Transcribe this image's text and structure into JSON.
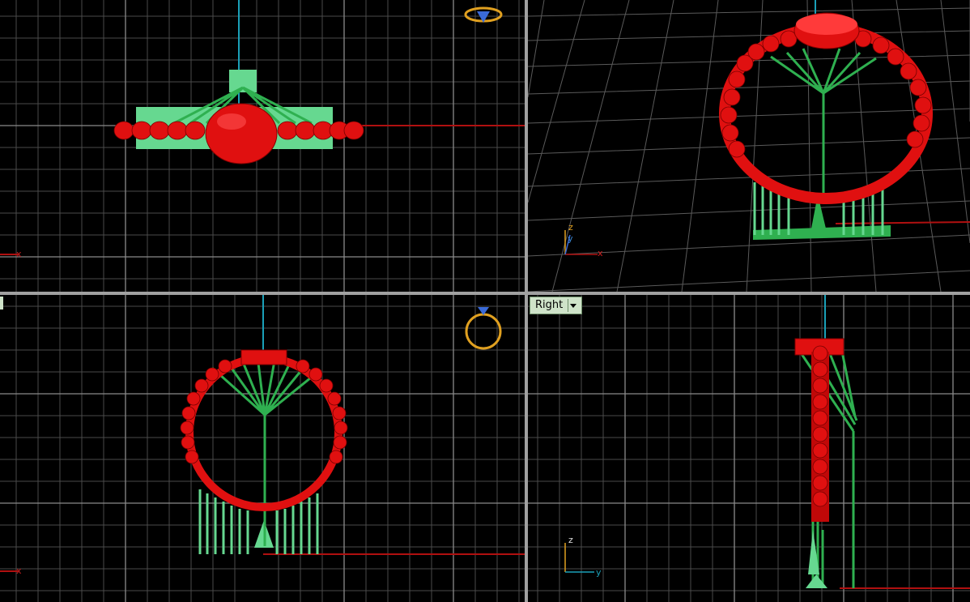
{
  "viewports": {
    "top": {
      "label": ""
    },
    "perspective": {
      "label": ""
    },
    "front": {
      "label": ""
    },
    "right": {
      "label": "Right"
    }
  },
  "axis_labels": {
    "x": "x",
    "y": "y",
    "z": "z"
  },
  "colors": {
    "background": "#000000",
    "grid": "#555555",
    "axis_x": "#b01010",
    "axis_z": "#1aa0b8",
    "ring_red": "#e01010",
    "support_green": "#2fb050",
    "base_green": "#66d890",
    "widget_gold": "#e0a020",
    "widget_blue": "#3a6ad8"
  },
  "icons": [
    "view-cube-ring-icon",
    "dropdown-arrow-icon",
    "axes-gizmo-icon"
  ]
}
